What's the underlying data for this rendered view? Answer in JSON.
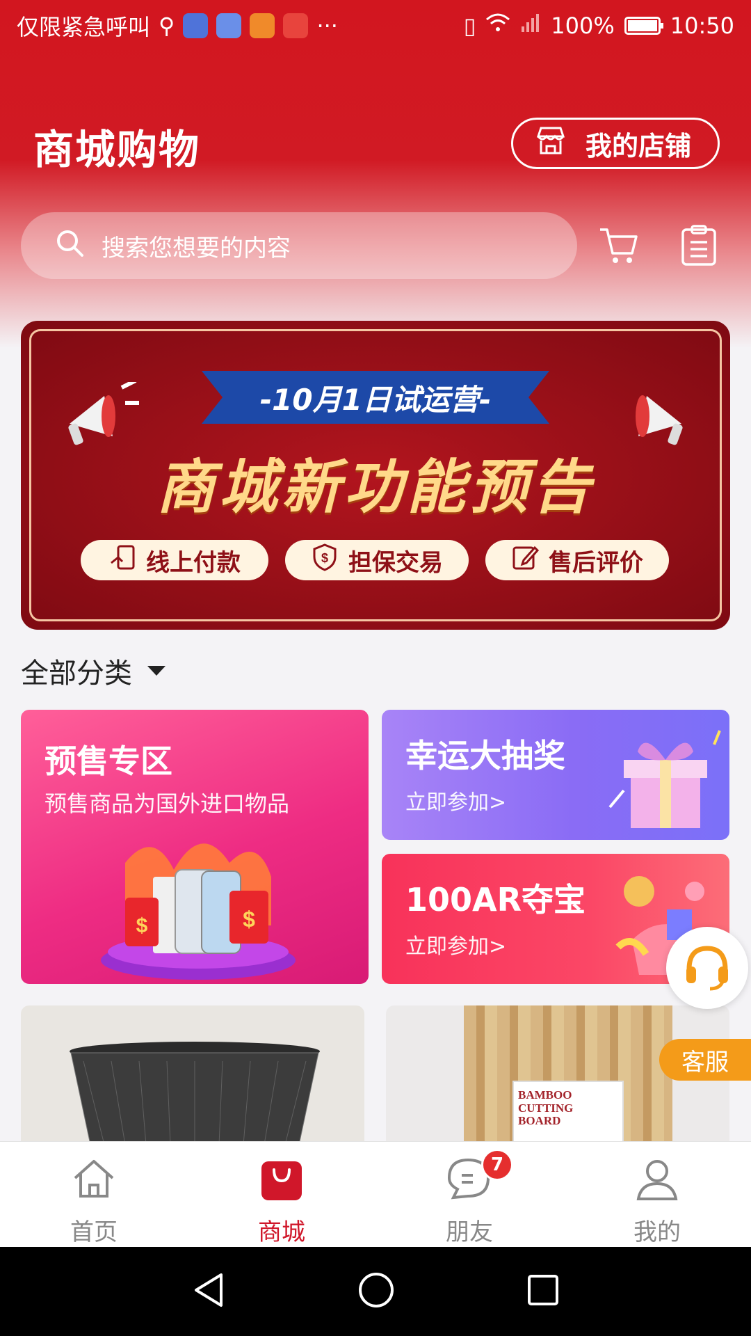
{
  "status_bar": {
    "carrier": "仅限紧急呼叫",
    "battery": "100%",
    "time": "10:50",
    "more": "···"
  },
  "header": {
    "title": "商城购物",
    "my_store_label": "我的店铺",
    "search_placeholder": "搜索您想要的内容"
  },
  "banner": {
    "ribbon": "-10月1日试运营-",
    "headline": "商城新功能预告",
    "pills": [
      "线上付款",
      "担保交易",
      "售后评价"
    ]
  },
  "category": {
    "label": "全部分类"
  },
  "promos": {
    "presale": {
      "title": "预售专区",
      "subtitle": "预售商品为国外进口物品"
    },
    "lottery": {
      "title": "幸运大抽奖",
      "subtitle": "立即参加>"
    },
    "treasure": {
      "title": "100AR夺宝",
      "subtitle": "立即参加>"
    }
  },
  "products": {
    "cutting_board_text": "BAMBOO CUTTING BOARD"
  },
  "customer_service": {
    "label": "客服"
  },
  "tabbar": {
    "tabs": [
      {
        "label": "首页"
      },
      {
        "label": "商城"
      },
      {
        "label": "朋友",
        "badge": "7"
      },
      {
        "label": "我的"
      }
    ]
  },
  "colors": {
    "brand_red": "#d2161f",
    "active_tab": "#d0172a",
    "service_orange": "#f49b19"
  }
}
